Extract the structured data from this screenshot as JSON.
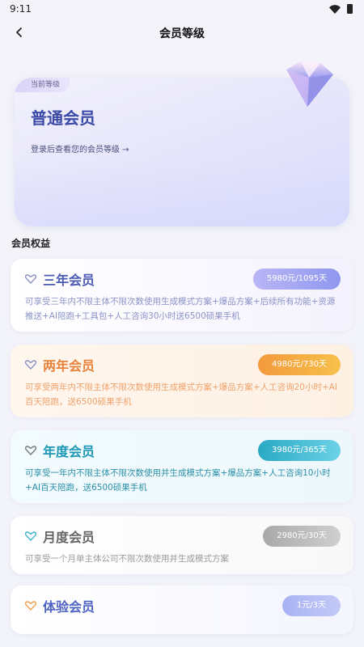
{
  "status_bar": {
    "time": "9:11"
  },
  "nav": {
    "title": "会员等级"
  },
  "hero": {
    "tag": "当前等级",
    "level": "普通会员",
    "hint": "登录后查看您的会员等级 →"
  },
  "section": {
    "title": "会员权益"
  },
  "plans": [
    {
      "name": "三年会员",
      "price": "5980元/1095天",
      "description": "可享受三年内不限主体不限次数使用生成模式方案+爆品方案+后续所有功能+资源推送+AI陪跑+工具包+人工咨询30小时送6500硕果手机"
    },
    {
      "name": "两年会员",
      "price": "4980元/730天",
      "description": "可享受两年内不限主体不限次数使用生成模式方案+爆品方案+人工咨询20小时+AI百天陪跑，送6500硕果手机"
    },
    {
      "name": "年度会员",
      "price": "3980元/365天",
      "description": "可享受一年内不限主体不限次数使用并生成模式方案+爆品方案+人工咨询10小时+AI百天陪跑，送6500硕果手机"
    },
    {
      "name": "月度会员",
      "price": "2980元/30天",
      "description": "可享受一个月单主体公司不限次数使用并生成模式方案"
    },
    {
      "name": "体验会员",
      "price": "1元/3天",
      "description": ""
    }
  ],
  "colors": {
    "accent": "#3a4aa6",
    "three_year": "#4b5ab3",
    "two_year": "#e8823a",
    "one_year": "#1d98b4",
    "monthly": "#666666",
    "trial": "#4f63c4"
  },
  "icons": {
    "back": "chevron-left-icon",
    "plan": "heart-badge-icon",
    "hero": "diamond-icon",
    "wifi": "wifi-icon",
    "battery": "battery-icon"
  }
}
